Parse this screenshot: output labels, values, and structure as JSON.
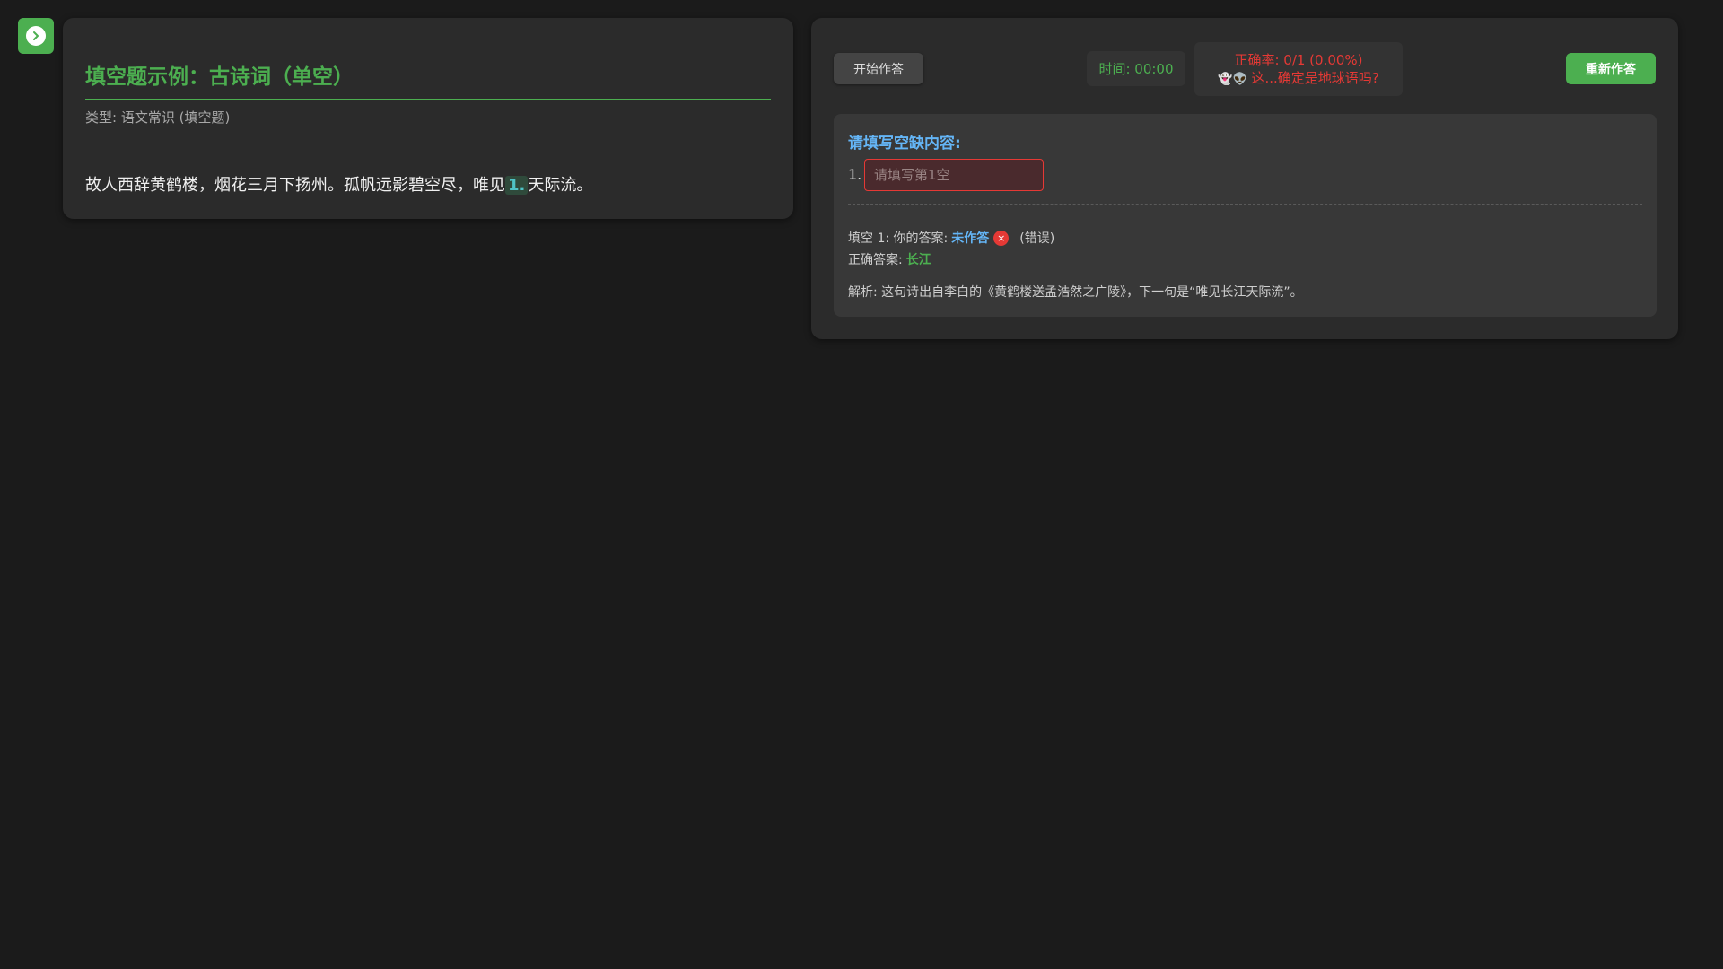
{
  "sidebar_toggle": {
    "icon": "chevron-right-icon"
  },
  "question": {
    "title": "填空题示例：古诗词（单空）",
    "type": "类型: 语文常识 (填空题)",
    "text_before": "故人西辞黄鹤楼，烟花三月下扬州。孤帆远影碧空尽，唯见",
    "blank_marker": "1.",
    "text_after": "天际流。"
  },
  "toolbar": {
    "start_label": "开始作答",
    "timer": "时间: 00:00",
    "accuracy": "正确率: 0/1 (0.00%)",
    "accuracy_emoji": "👻👽",
    "accuracy_comment": "这...确定是地球语吗?",
    "redo_label": "重新作答"
  },
  "answer": {
    "prompt": "请填写空缺内容:",
    "blank_number": "1.",
    "input_placeholder": "请填写第1空",
    "input_value": "",
    "feedback_prefix": "填空 1: 你的答案:",
    "your_answer": "未作答",
    "wrong_icon": "×",
    "wrong_label": "(错误)",
    "correct_prefix": "正确答案:",
    "correct_answer": "长江",
    "analysis": "解析: 这句诗出自李白的《黄鹤楼送孟浩然之广陵》，下一句是“唯见长江天际流”。"
  },
  "colors": {
    "accent": "#4caf50",
    "error": "#e53935",
    "info": "#64b5f6",
    "background": "#1b1b1b",
    "panel": "#2b2b2b"
  }
}
